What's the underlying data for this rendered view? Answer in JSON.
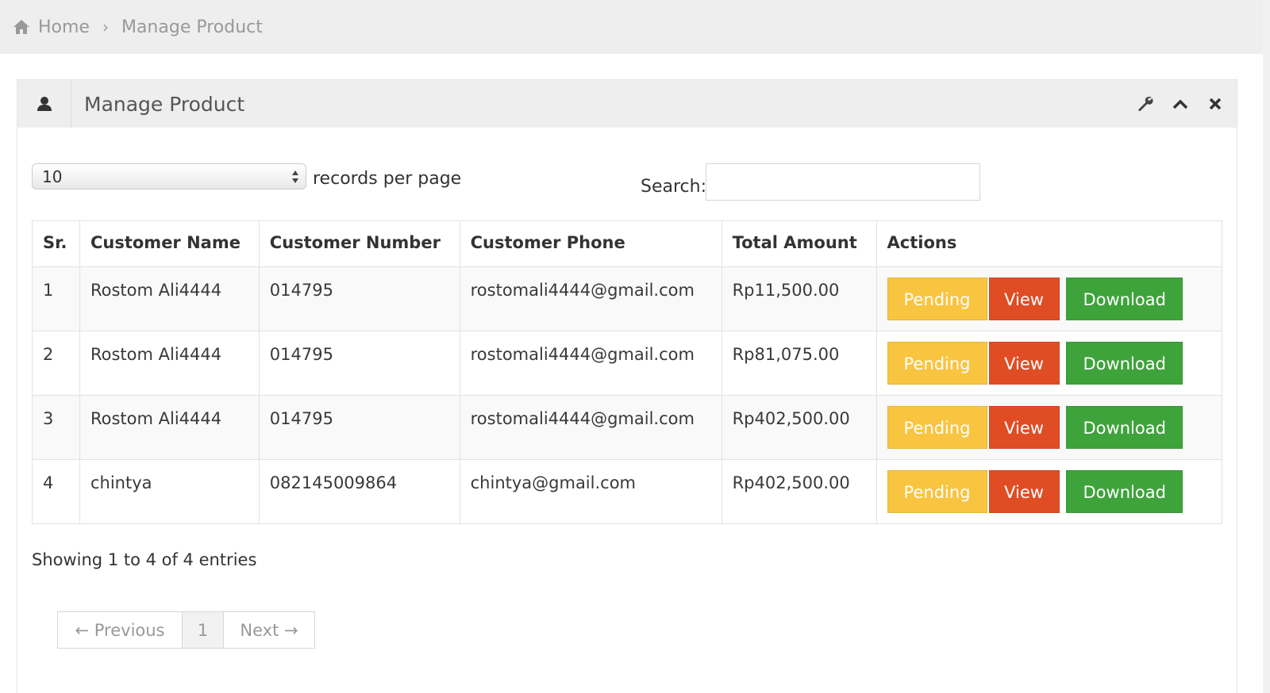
{
  "breadcrumb": {
    "home": "Home",
    "current": "Manage Product"
  },
  "widget": {
    "title": "Manage Product"
  },
  "controls": {
    "page_size": "10",
    "page_size_label": "records per page",
    "search_label": "Search:",
    "search_value": ""
  },
  "table": {
    "headers": [
      "Sr.",
      "Customer Name",
      "Customer Number",
      "Customer Phone",
      "Total Amount",
      "Actions"
    ],
    "rows": [
      {
        "sr": "1",
        "name": "Rostom Ali4444",
        "number": "014795",
        "phone": "rostomali4444@gmail.com",
        "amount": "Rp11,500.00"
      },
      {
        "sr": "2",
        "name": "Rostom Ali4444",
        "number": "014795",
        "phone": "rostomali4444@gmail.com",
        "amount": "Rp81,075.00"
      },
      {
        "sr": "3",
        "name": "Rostom Ali4444",
        "number": "014795",
        "phone": "rostomali4444@gmail.com",
        "amount": "Rp402,500.00"
      },
      {
        "sr": "4",
        "name": "chintya",
        "number": "082145009864",
        "phone": "chintya@gmail.com",
        "amount": "Rp402,500.00"
      }
    ],
    "actions": {
      "pending": "Pending",
      "view": "View",
      "download": "Download"
    }
  },
  "info": "Showing 1 to 4 of 4 entries",
  "pagination": {
    "previous": "← Previous",
    "page": "1",
    "next": "Next →"
  },
  "colors": {
    "pending": "#f9c43f",
    "view": "#e04d24",
    "download": "#3ea33a"
  },
  "icons": {
    "breadcrumb": "home-icon",
    "header": "user-icon",
    "toolbar": [
      "wrench-icon",
      "chevron-up-icon",
      "close-icon"
    ]
  }
}
